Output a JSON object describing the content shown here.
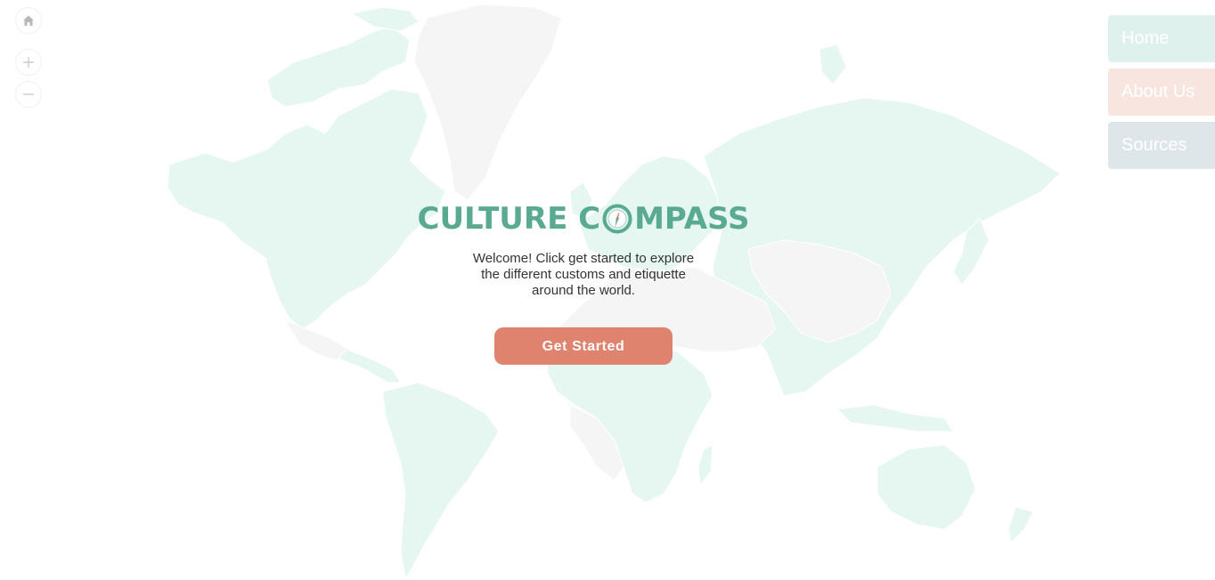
{
  "map": {
    "land_color": "#e6f6f1",
    "land_muted_color": "#f5f5f5",
    "controls": {
      "home_icon": "home-icon",
      "zoom_in_icon": "plus-icon",
      "zoom_out_icon": "minus-icon"
    }
  },
  "nav": {
    "items": [
      {
        "label": "Home",
        "color": "#dff1ec"
      },
      {
        "label": "About Us",
        "color": "#f8e5df"
      },
      {
        "label": "Sources",
        "color": "#dfe6e9"
      }
    ]
  },
  "hero": {
    "logo_part1": "CULTURE C",
    "logo_part2": "MPASS",
    "logo_color": "#5aaa92",
    "logo_icon": "compass-icon",
    "welcome_text": "Welcome! Click get started to explore the different customs and etiquette around the world.",
    "cta_label": "Get Started",
    "cta_color": "#e0836e"
  }
}
